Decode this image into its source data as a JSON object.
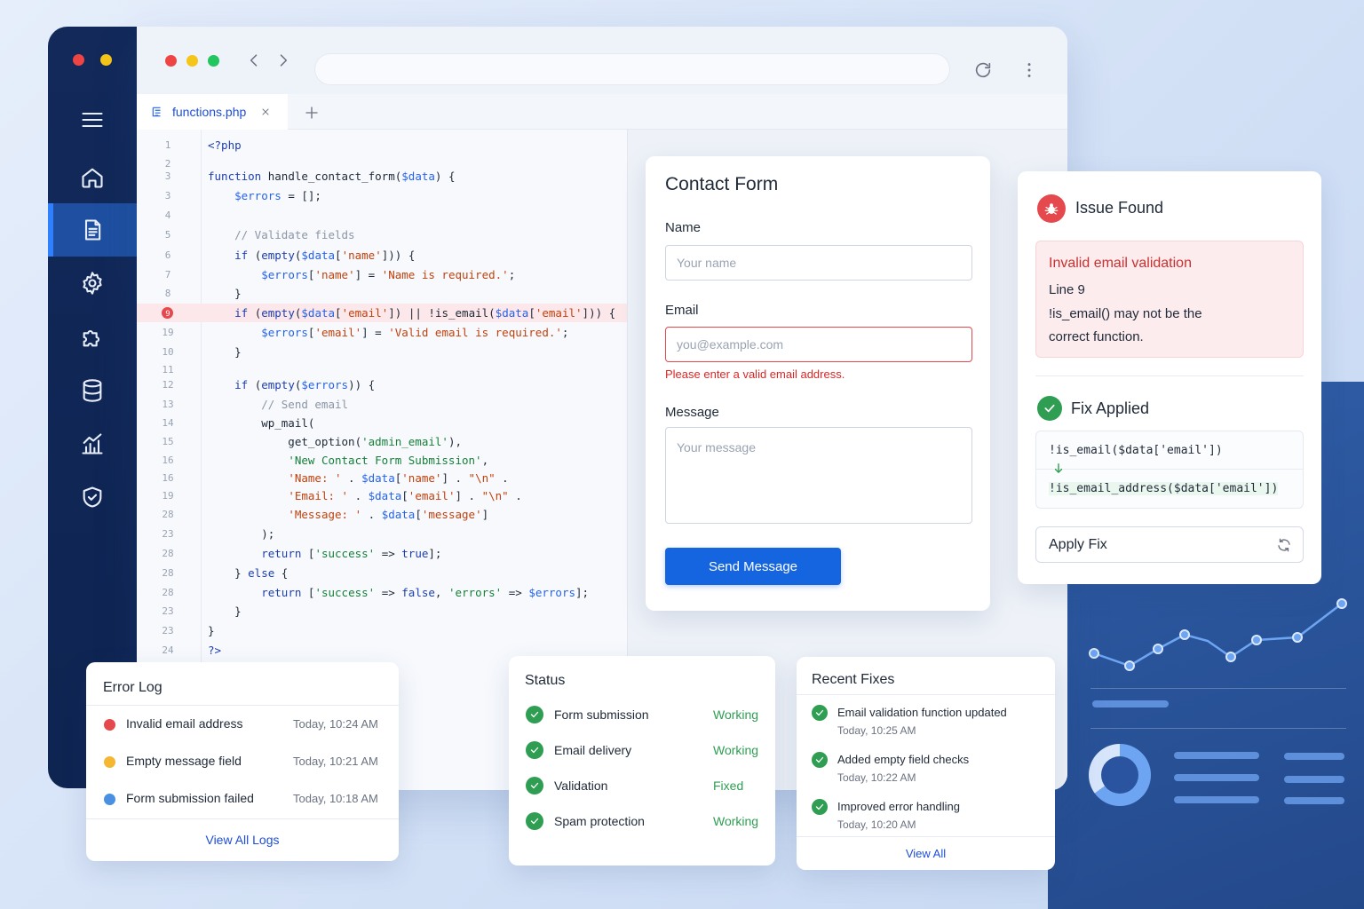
{
  "editor": {
    "tab_title": "functions.php",
    "lines": [
      {
        "n": "1",
        "text": "<?php"
      },
      {
        "n": "2",
        "text": ""
      },
      {
        "n": "3",
        "text": "function handle_contact_form($data) {"
      },
      {
        "n": "3",
        "text": "    $errors = [];"
      },
      {
        "n": "4",
        "text": ""
      },
      {
        "n": "5",
        "text": "    // Validate fields"
      },
      {
        "n": "6",
        "text": "    if (empty($data['name'])) {"
      },
      {
        "n": "7",
        "text": "        $errors['name'] = 'Name is required.';"
      },
      {
        "n": "8",
        "text": "    }"
      },
      {
        "n": "9",
        "text": "    if (empty($data['email']) || !is_email($data['email'])) {"
      },
      {
        "n": "19",
        "text": "        $errors['email'] = 'Valid email is required.';"
      },
      {
        "n": "10",
        "text": "    }"
      },
      {
        "n": "11",
        "text": ""
      },
      {
        "n": "12",
        "text": "    if (empty($errors)) {"
      },
      {
        "n": "13",
        "text": "        // Send email"
      },
      {
        "n": "14",
        "text": "        wp_mail("
      },
      {
        "n": "15",
        "text": "            get_option('admin_email'),"
      },
      {
        "n": "16",
        "text": "            'New Contact Form Submission',"
      },
      {
        "n": "16",
        "text": "            'Name: ' . $data['name'] . \"\\n\" ."
      },
      {
        "n": "19",
        "text": "            'Email: ' . $data['email'] . \"\\n\" ."
      },
      {
        "n": "28",
        "text": "            'Message: ' . $data['message']"
      },
      {
        "n": "23",
        "text": "        );"
      },
      {
        "n": "28",
        "text": "        return ['success' => true];"
      },
      {
        "n": "28",
        "text": "    } else {"
      },
      {
        "n": "28",
        "text": "        return ['success' => false, 'errors' => $errors];"
      },
      {
        "n": "23",
        "text": "    }"
      },
      {
        "n": "23",
        "text": "}"
      },
      {
        "n": "24",
        "text": "?>"
      }
    ]
  },
  "contact_form": {
    "title": "Contact Form",
    "name_label": "Name",
    "name_placeholder": "Your name",
    "email_label": "Email",
    "email_placeholder": "you@example.com",
    "email_error": "Please enter a valid email address.",
    "message_label": "Message",
    "message_placeholder": "Your message",
    "submit_label": "Send Message"
  },
  "issue": {
    "title": "Issue Found",
    "error_title": "Invalid email validation",
    "line": "Line 9",
    "desc_1": "!is_email() may not be the",
    "desc_2": "correct function.",
    "fix_title": "Fix Applied",
    "before": "!is_email($data['email'])",
    "after": "!is_email_address($data['email'])",
    "apply_label": "Apply Fix"
  },
  "error_log": {
    "title": "Error Log",
    "items": [
      {
        "text": "Invalid email address",
        "time": "Today, 10:24 AM",
        "color": "#e5484d"
      },
      {
        "text": "Empty message field",
        "time": "Today, 10:21 AM",
        "color": "#f5b731"
      },
      {
        "text": "Form submission failed",
        "time": "Today, 10:18 AM",
        "color": "#4a90e2"
      }
    ],
    "view_all": "View All Logs"
  },
  "status": {
    "title": "Status",
    "items": [
      {
        "label": "Form submission",
        "state": "Working"
      },
      {
        "label": "Email delivery",
        "state": "Working"
      },
      {
        "label": "Validation",
        "state": "Fixed"
      },
      {
        "label": "Spam protection",
        "state": "Working"
      }
    ]
  },
  "recent_fixes": {
    "title": "Recent Fixes",
    "items": [
      {
        "text": "Email validation function updated",
        "time": "Today, 10:25 AM"
      },
      {
        "text": "Added empty field checks",
        "time": "Today, 10:22 AM"
      },
      {
        "text": "Improved error handling",
        "time": "Today, 10:20 AM"
      }
    ],
    "view_all": "View All"
  },
  "colors": {
    "accent": "#1565e0",
    "sidebar": "#12295a",
    "error": "#e5484d",
    "success": "#2f9e53"
  }
}
